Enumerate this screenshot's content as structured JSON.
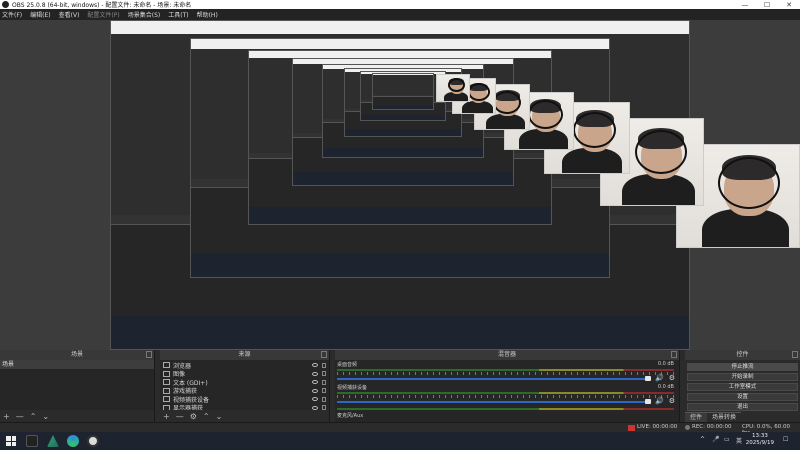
{
  "window": {
    "title": "OBS 25.0.8 (64-bit, windows) - 配置文件: 未命名 - 场景: 未命名",
    "minimize": "—",
    "maximize": "☐",
    "close": "✕"
  },
  "menu": [
    "文件(F)",
    "编辑(E)",
    "查看(V)",
    "配置文件(P)",
    "场景集合(S)",
    "工具(T)",
    "帮助(H)"
  ],
  "panels": {
    "scenes_title": "场景",
    "sources_title": "来源",
    "mixer_title": "混音器",
    "controls_title": "控件"
  },
  "scenes": [
    "场景"
  ],
  "sources": [
    {
      "label": "浏览器",
      "icon": "globe-icon"
    },
    {
      "label": "图像",
      "icon": "image-icon"
    },
    {
      "label": "文本 (GDI+)",
      "icon": "text-icon"
    },
    {
      "label": "游戏捕获",
      "icon": "gamepad-icon"
    },
    {
      "label": "视频捕获设备",
      "icon": "camera-icon"
    },
    {
      "label": "显示器捕获",
      "icon": "monitor-icon"
    }
  ],
  "mixer": [
    {
      "label": "桌面音频",
      "db": "0.0 dB"
    },
    {
      "label": "视频捕获设备",
      "db": "0.0 dB"
    },
    {
      "label": "麦克风/Aux",
      "db": ""
    }
  ],
  "controls": [
    "停止推流",
    "开始录制",
    "工作室模式",
    "设置",
    "退出"
  ],
  "control_tabs": [
    "控件",
    "场景转换"
  ],
  "footer_icons": {
    "add": "+",
    "remove": "—",
    "up": "⌃",
    "down": "⌄",
    "gear": "⚙"
  },
  "status": {
    "live": "LIVE: 00:00:00",
    "rec": "REC: 00:00:00",
    "cpu": "CPU: 0.0%, 60.00 fps",
    "live_label": "LIVE"
  },
  "taskbar": {
    "time": "13:33",
    "date": "2025/9/19",
    "ime": "英",
    "chevron": "^",
    "notify": "☐"
  },
  "colors": {
    "meter_green": "#2d6b2d",
    "meter_yellow": "#8a8a28",
    "meter_red": "#8a2b2b",
    "slider_blue": "#2e66c8",
    "taskbar": "#1d2430"
  }
}
